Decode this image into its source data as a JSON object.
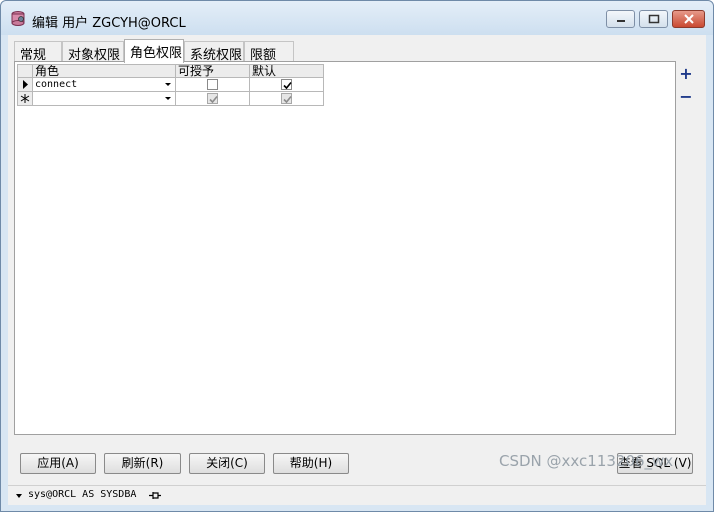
{
  "window": {
    "title": "编辑 用户 ZGCYH@ORCL"
  },
  "tabs": [
    {
      "label": "常规",
      "active": false
    },
    {
      "label": "对象权限",
      "active": false
    },
    {
      "label": "角色权限",
      "active": true
    },
    {
      "label": "系统权限",
      "active": false
    },
    {
      "label": "限额",
      "active": false
    }
  ],
  "grid": {
    "columns": [
      "角色",
      "可授予",
      "默认"
    ],
    "rows": [
      {
        "indicator": "current-row",
        "role": "connect",
        "grantable": false,
        "default": true
      },
      {
        "indicator": "new-row",
        "role": "",
        "grantable": true,
        "default": true
      }
    ]
  },
  "side_tools": {
    "add_label": "+",
    "remove_label": "−"
  },
  "buttons": {
    "apply": "应用(A)",
    "refresh": "刷新(R)",
    "close": "关闭(C)",
    "help": "帮助(H)",
    "view_sql": "查看 SQL (V)"
  },
  "status": {
    "connection": "sys@ORCL AS SYSDBA"
  },
  "watermark": "CSDN @xxc113206_wx",
  "colors": {
    "accent": "#1f3a8a",
    "close_button": "#c94a32"
  }
}
